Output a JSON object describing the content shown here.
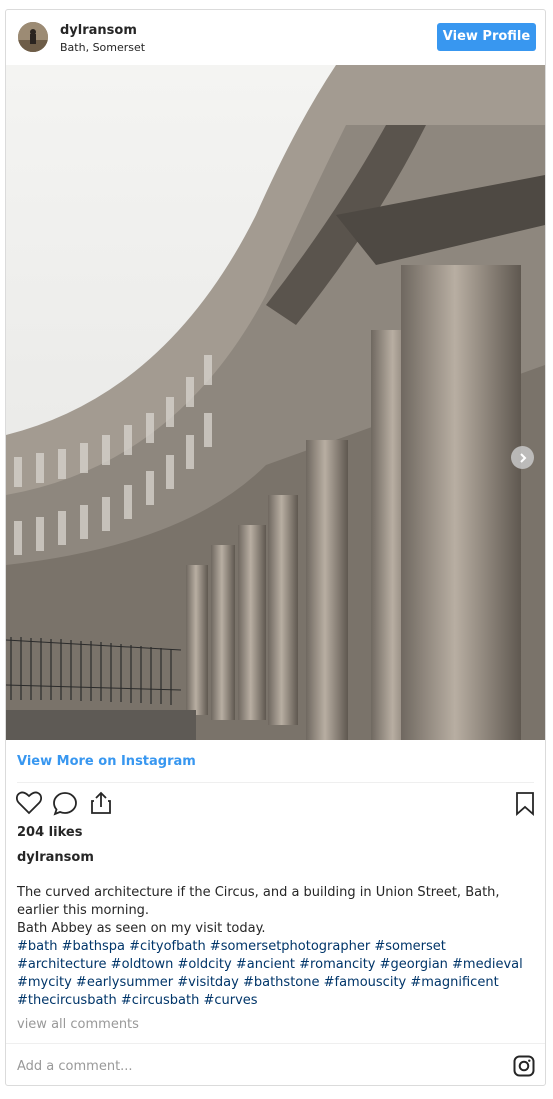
{
  "header": {
    "username": "dylransom",
    "location": "Bath, Somerset",
    "view_profile_label": "View Profile"
  },
  "post": {
    "view_more_label": "View More on Instagram",
    "likes": "204 likes",
    "caption_user": "dylransom",
    "caption_text": "The curved architecture if the Circus, and a building in Union Street, Bath, earlier this morning.",
    "caption_line2": "Bath Abbey as seen on my visit today.",
    "hashtags": "#bath #bathspa #cityofbath #somersetphotographer #somerset #architecture #oldtown #oldcity #ancient #romancity #georgian #medieval #mycity #earlysummer #visitday #bathstone #famouscity #magnificent #thecircusbath #circusbath #curves",
    "view_comments_label": "view all comments",
    "comment_placeholder": "Add a comment..."
  },
  "icons": {
    "like": "heart-icon",
    "comment": "comment-icon",
    "share": "share-icon",
    "save": "bookmark-icon",
    "next": "chevron-right-icon",
    "instagram": "instagram-icon"
  },
  "colors": {
    "accent": "#3897f0",
    "hashtag": "#003569",
    "muted": "#999999",
    "border": "#dbdbdb"
  }
}
